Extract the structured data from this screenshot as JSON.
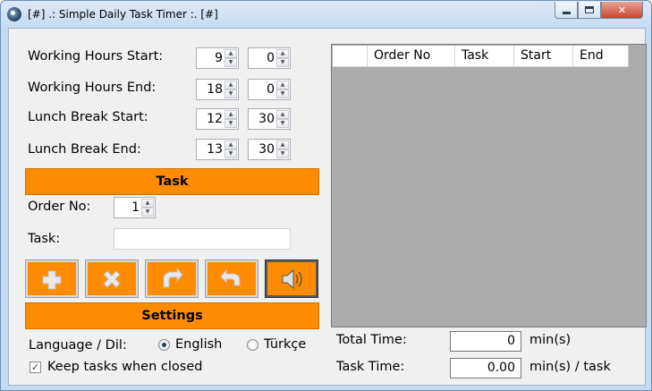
{
  "window": {
    "title": "[#] .: Simple Daily Task Timer :. [#]"
  },
  "hours": {
    "work_start_label": "Working Hours Start:",
    "work_start_h": "9",
    "work_start_m": "0",
    "work_end_label": "Working Hours End:",
    "work_end_h": "18",
    "work_end_m": "0",
    "lunch_start_label": "Lunch Break Start:",
    "lunch_start_h": "12",
    "lunch_start_m": "30",
    "lunch_end_label": "Lunch Break End:",
    "lunch_end_h": "13",
    "lunch_end_m": "30"
  },
  "task": {
    "header": "Task",
    "order_label": "Order No:",
    "order_value": "1",
    "task_label": "Task:",
    "task_value": "",
    "buttons": [
      "add-icon",
      "delete-icon",
      "undo-icon",
      "redo-icon",
      "speaker-icon"
    ]
  },
  "settings": {
    "header": "Settings",
    "language_label": "Language / Dil:",
    "lang_english": "English",
    "lang_turkish": "Türkçe",
    "selected_language": "English",
    "keep_tasks_label": "Keep tasks when closed",
    "keep_tasks_checked": true
  },
  "grid": {
    "columns": [
      "Order No",
      "Task",
      "Start",
      "End"
    ]
  },
  "summary": {
    "total_label": "Total Time:",
    "total_value": "0",
    "total_unit": "min(s)",
    "task_label": "Task Time:",
    "task_value": "0.00",
    "task_unit": "min(s) / task"
  },
  "colors": {
    "accent": "#ff8c00",
    "grid_bg": "#ababab"
  }
}
